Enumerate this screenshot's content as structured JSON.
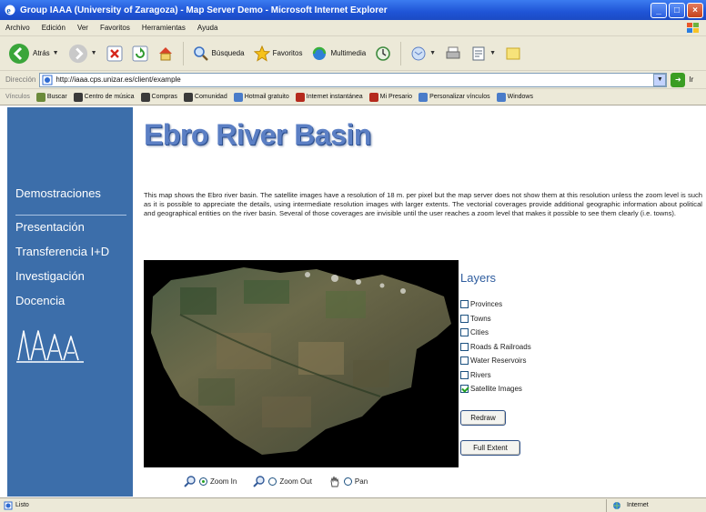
{
  "window": {
    "title": "Group IAAA (University of Zaragoza) - Map Server Demo - Microsoft Internet Explorer",
    "minimize": "_",
    "maximize": "□",
    "close": "×"
  },
  "menu": [
    "Archivo",
    "Edición",
    "Ver",
    "Favoritos",
    "Herramientas",
    "Ayuda"
  ],
  "toolbar": {
    "back_label": "Atrás",
    "search_label": "Búsqueda",
    "favorites_label": "Favoritos",
    "multimedia_label": "Multimedia"
  },
  "address": {
    "label": "Dirección",
    "url": "http://iaaa.cps.unizar.es/client/example",
    "go_label": "Ir"
  },
  "links": {
    "label": "Vínculos",
    "items": [
      {
        "label": "Buscar",
        "color": "#6b8a3a"
      },
      {
        "label": "Centro de música",
        "color": "#3a3a3a"
      },
      {
        "label": "Compras",
        "color": "#3a3a3a"
      },
      {
        "label": "Comunidad",
        "color": "#3a3a3a"
      },
      {
        "label": "Hotmail gratuito",
        "color": "#4a7cc9"
      },
      {
        "label": "Internet instantánea",
        "color": "#b52a1d"
      },
      {
        "label": "Mi Presario",
        "color": "#b52a1d"
      },
      {
        "label": "Personalizar vínculos",
        "color": "#4a7cc9"
      },
      {
        "label": "Windows",
        "color": "#4a7cc9"
      }
    ]
  },
  "sidebar": {
    "top": "Demostraciones",
    "items": [
      "Presentación",
      "Transferencia I+D",
      "Investigación",
      "Docencia"
    ]
  },
  "main": {
    "title": "Ebro River Basin",
    "description": "This map shows the Ebro river basin. The satellite images have a resolution of 18 m. per pixel but the map server does not show them at this resolution unless the zoom level is such as it is possible to appreciate the details, using intermediate resolution images with larger extents. The vectorial coverages provide additional geographic information about political and geographical entities on the river basin. Several of those coverages are invisible until the user reaches a zoom level that makes it possible to see them clearly (i.e. towns)."
  },
  "layers": {
    "title": "Layers",
    "items": [
      {
        "label": "Provinces",
        "checked": false
      },
      {
        "label": "Towns",
        "checked": false
      },
      {
        "label": "Cities",
        "checked": false
      },
      {
        "label": "Roads & Railroads",
        "checked": false
      },
      {
        "label": "Water Reservoirs",
        "checked": false
      },
      {
        "label": "Rivers",
        "checked": false
      },
      {
        "label": "Satellite Images",
        "checked": true
      }
    ],
    "redraw_label": "Redraw",
    "full_extent_label": "Full Extent"
  },
  "tools": {
    "zoom_in_label": "Zoom In",
    "zoom_out_label": "Zoom Out",
    "pan_label": "Pan",
    "selected": "zoom_in"
  },
  "status": {
    "left": "Listo",
    "zone": "Internet"
  }
}
